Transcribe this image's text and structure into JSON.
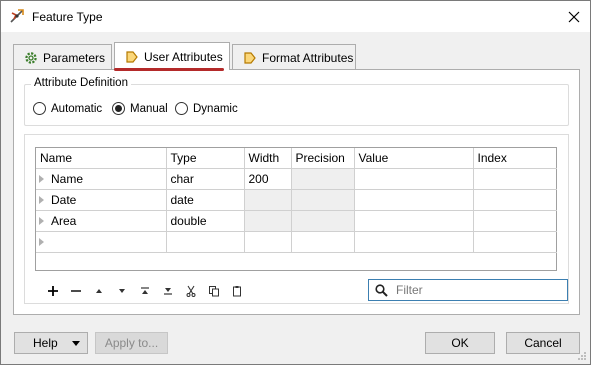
{
  "window": {
    "title": "Feature Type"
  },
  "tabs": [
    {
      "label": "Parameters",
      "icon": "gear-icon"
    },
    {
      "label": "User Attributes",
      "icon": "arrow-tag-icon"
    },
    {
      "label": "Format Attributes",
      "icon": "arrow-tag-icon"
    }
  ],
  "attribute_definition": {
    "label": "Attribute Definition",
    "options": [
      "Automatic",
      "Manual",
      "Dynamic"
    ],
    "selected": "Manual"
  },
  "table": {
    "headers": [
      "Name",
      "Type",
      "Width",
      "Precision",
      "Value",
      "Index"
    ],
    "rows": [
      {
        "name": "Name",
        "type": "char",
        "width": "200",
        "precision": "",
        "value": "",
        "index": ""
      },
      {
        "name": "Date",
        "type": "date",
        "width": "",
        "precision": "",
        "value": "",
        "index": ""
      },
      {
        "name": "Area",
        "type": "double",
        "width": "",
        "precision": "",
        "value": "",
        "index": ""
      },
      {
        "name": "",
        "type": "",
        "width": "",
        "precision": "",
        "value": "",
        "index": ""
      }
    ]
  },
  "toolbar": {
    "icons": [
      "add-icon",
      "remove-icon",
      "move-up-icon",
      "move-down-icon",
      "move-top-icon",
      "move-bottom-icon",
      "cut-icon",
      "copy-icon",
      "paste-icon"
    ]
  },
  "filter": {
    "placeholder": "Filter",
    "value": ""
  },
  "buttons": {
    "help": "Help",
    "apply": "Apply to...",
    "ok": "OK",
    "cancel": "Cancel"
  },
  "colors": {
    "accent_underline": "#b42a2a",
    "filter_border": "#3c7fb1",
    "tab_icon": "#e8a400"
  }
}
